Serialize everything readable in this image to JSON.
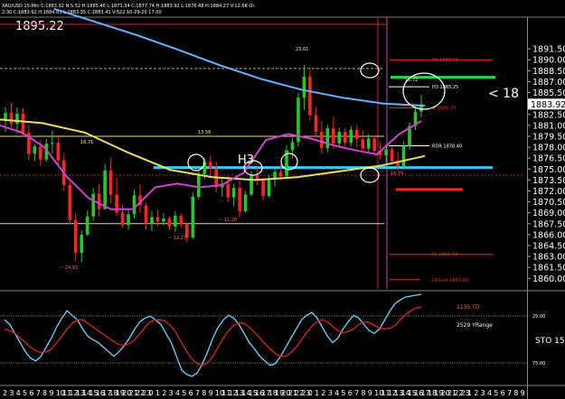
{
  "chart_data": [
    {
      "type": "candlestick",
      "header": "XAU/USD  15-Min  C:1883.92  N:5.52  H:1885.46  L:1873.34  C:1877.74  H:1883.92  L:1876.48  H:1884.27  V:12.6K  Oi:",
      "header2": "2:30  C:1883.92  H:1884.83  L:1883.35  C:1883.41  V:522  10-29-20  17:00",
      "corner_price": "1895.22",
      "price_axis": {
        "ticks": [
          "1891.50",
          "1890.00",
          "1888.50",
          "1887.00",
          "1885.50",
          "1884.00",
          "1882.50",
          "1881.00",
          "1879.50",
          "1878.00",
          "1876.50",
          "1875.00",
          "1873.50",
          "1872.00",
          "1870.50",
          "1869.00",
          "1867.50",
          "1866.00",
          "1864.50",
          "1863.00",
          "1861.50",
          "1860.00"
        ],
        "ylim": [
          1858.8,
          1893.5
        ],
        "last_price": "1883.92",
        "scale_note": "STO 15"
      },
      "x_axis": {
        "labels": [
          "2",
          "3",
          "4",
          "5",
          "6",
          "7",
          "8",
          "9",
          "10",
          "11",
          "12",
          "13",
          "14",
          "15",
          "16",
          "17",
          "18",
          "19",
          "20",
          "21",
          "22",
          "23",
          "0",
          "1",
          "2",
          "3",
          "4",
          "5",
          "6",
          "7",
          "8",
          "9",
          "10",
          "11",
          "12",
          "13",
          "14",
          "15",
          "16",
          "17",
          "18",
          "19",
          "20",
          "21",
          "22",
          "23",
          "0",
          "1",
          "2",
          "3",
          "4",
          "5",
          "6",
          "7",
          "8",
          "9",
          "10",
          "11",
          "12",
          "13",
          "14",
          "15",
          "16",
          "17",
          "18",
          "19",
          "20",
          "21",
          "22",
          "23",
          "1",
          "2",
          "3",
          "4",
          "5",
          "6",
          "7",
          "8",
          "9"
        ]
      },
      "candles": [
        [
          1881.6,
          1883.5,
          1880.1,
          1882.7
        ],
        [
          1882.7,
          1884.1,
          1880.7,
          1881.2
        ],
        [
          1881.2,
          1883.5,
          1879.9,
          1882.6
        ],
        [
          1882.6,
          1883.4,
          1879.4,
          1880.0
        ],
        [
          1880.0,
          1881.1,
          1876.2,
          1877.1
        ],
        [
          1877.1,
          1878.4,
          1876.1,
          1878.1
        ],
        [
          1878.1,
          1879.0,
          1875.4,
          1876.3
        ],
        [
          1876.3,
          1879.1,
          1876.0,
          1878.5
        ],
        [
          1878.5,
          1880.3,
          1877.1,
          1878.6
        ],
        [
          1878.6,
          1879.5,
          1875.6,
          1876.2
        ],
        [
          1876.2,
          1877.1,
          1872.0,
          1872.8
        ],
        [
          1872.8,
          1873.3,
          1867.4,
          1868.0
        ],
        [
          1868.0,
          1868.9,
          1862.4,
          1863.5
        ],
        [
          1863.5,
          1866.6,
          1862.2,
          1866.0
        ],
        [
          1866.0,
          1869.3,
          1865.8,
          1868.5
        ],
        [
          1868.5,
          1872.4,
          1867.9,
          1871.6
        ],
        [
          1871.6,
          1872.9,
          1868.5,
          1869.5
        ],
        [
          1869.5,
          1875.7,
          1869.4,
          1874.8
        ],
        [
          1874.8,
          1876.6,
          1870.3,
          1871.5
        ],
        [
          1871.5,
          1873.8,
          1868.6,
          1869.0
        ],
        [
          1869.0,
          1870.1,
          1866.9,
          1867.3
        ],
        [
          1867.3,
          1869.6,
          1866.7,
          1868.8
        ],
        [
          1868.8,
          1872.2,
          1868.2,
          1871.4
        ],
        [
          1871.4,
          1872.9,
          1868.9,
          1870.0
        ],
        [
          1870.0,
          1870.4,
          1866.7,
          1867.5
        ],
        [
          1867.5,
          1869.2,
          1866.5,
          1868.4
        ],
        [
          1868.4,
          1869.4,
          1867.2,
          1867.8
        ],
        [
          1867.8,
          1869.0,
          1867.3,
          1868.2
        ],
        [
          1868.2,
          1868.5,
          1866.6,
          1867.1
        ],
        [
          1867.1,
          1869.2,
          1866.4,
          1868.6
        ],
        [
          1868.6,
          1868.9,
          1866.9,
          1867.4
        ],
        [
          1867.4,
          1867.7,
          1865.0,
          1865.6
        ],
        [
          1865.6,
          1871.8,
          1865.4,
          1871.2
        ],
        [
          1871.2,
          1875.0,
          1870.9,
          1874.3
        ],
        [
          1874.3,
          1876.5,
          1873.6,
          1876.0
        ],
        [
          1876.0,
          1876.9,
          1874.2,
          1875.1
        ],
        [
          1875.1,
          1876.0,
          1871.8,
          1872.5
        ],
        [
          1872.5,
          1873.9,
          1871.2,
          1873.0
        ],
        [
          1873.0,
          1874.1,
          1870.5,
          1871.1
        ],
        [
          1871.1,
          1873.0,
          1869.9,
          1872.4
        ],
        [
          1872.4,
          1873.3,
          1868.3,
          1869.2
        ],
        [
          1869.2,
          1872.0,
          1869.0,
          1871.5
        ],
        [
          1871.5,
          1874.7,
          1871.3,
          1874.1
        ],
        [
          1874.1,
          1875.3,
          1872.8,
          1873.6
        ],
        [
          1873.6,
          1873.8,
          1870.7,
          1871.3
        ],
        [
          1871.3,
          1874.2,
          1871.1,
          1873.7
        ],
        [
          1873.7,
          1875.0,
          1872.6,
          1874.6
        ],
        [
          1874.6,
          1875.6,
          1873.5,
          1874.0
        ],
        [
          1874.0,
          1878.3,
          1873.8,
          1877.6
        ],
        [
          1877.6,
          1879.3,
          1876.4,
          1878.7
        ],
        [
          1878.7,
          1885.5,
          1878.1,
          1884.8
        ],
        [
          1884.8,
          1889.3,
          1883.1,
          1887.7
        ],
        [
          1887.7,
          1888.9,
          1881.7,
          1882.4
        ],
        [
          1882.4,
          1883.5,
          1879.2,
          1880.1
        ],
        [
          1880.1,
          1881.6,
          1877.1,
          1877.9
        ],
        [
          1877.9,
          1881.1,
          1877.3,
          1880.6
        ],
        [
          1880.6,
          1882.2,
          1877.8,
          1878.5
        ],
        [
          1878.5,
          1880.7,
          1877.9,
          1880.1
        ],
        [
          1880.1,
          1880.6,
          1877.9,
          1878.6
        ],
        [
          1878.6,
          1880.9,
          1878.1,
          1880.4
        ],
        [
          1880.4,
          1881.0,
          1878.0,
          1879.1
        ],
        [
          1879.1,
          1880.3,
          1877.2,
          1877.8
        ],
        [
          1877.8,
          1879.8,
          1877.3,
          1879.2
        ],
        [
          1879.2,
          1879.7,
          1876.9,
          1877.5
        ],
        [
          1877.5,
          1878.6,
          1876.3,
          1876.9
        ],
        [
          1876.9,
          1878.4,
          1875.8,
          1877.7
        ],
        [
          1877.7,
          1878.2,
          1875.6,
          1876.1
        ],
        [
          1876.1,
          1877.4,
          1874.8,
          1875.4
        ],
        [
          1875.4,
          1878.8,
          1875.1,
          1878.2
        ],
        [
          1878.2,
          1881.4,
          1877.7,
          1880.9
        ],
        [
          1880.9,
          1883.6,
          1880.4,
          1882.9
        ],
        [
          1882.9,
          1885.2,
          1882.1,
          1883.9
        ]
      ],
      "moving_averages": [
        {
          "color": "#66b3ff",
          "values": [
            1897.0,
            1895.2,
            1893.4,
            1891.4,
            1889.3,
            1887.4,
            1885.9,
            1884.8,
            1884.0,
            1883.7
          ]
        },
        {
          "color": "#e8e060",
          "values": [
            1881.8,
            1881.3,
            1880.0,
            1877.3,
            1874.9,
            1873.9,
            1873.5,
            1873.9,
            1874.7,
            1875.5,
            1876.8
          ]
        },
        {
          "color": "#d43fd1",
          "values": [
            1881.0,
            1880.0,
            1878.0,
            1874.0,
            1871.0,
            1869.5,
            1869.5,
            1872.5,
            1873.0,
            1872.5,
            1872.8,
            1874.5,
            1879.0,
            1879.8,
            1879.2,
            1878.3,
            1877.6,
            1877.0,
            1879.8,
            1881.6
          ]
        }
      ],
      "horizontal_levels": [
        {
          "price": 1875.2,
          "color": "#33ccff",
          "label": "H3",
          "emphasis": true
        },
        {
          "price": 1887.6,
          "color": "#22dd44",
          "label": "",
          "emphasis": true
        },
        {
          "price": 1888.8,
          "color": "#22dd44",
          "label": "",
          "emphasis": true
        },
        {
          "price": 1879.5,
          "color": "#e8e060",
          "label": ""
        },
        {
          "price": 1867.5,
          "color": "#e8e060",
          "label": ""
        },
        {
          "price": 1872.2,
          "color": "#ff2222",
          "label": "",
          "emphasis": true
        },
        {
          "price": 1890.0,
          "color": "#ff2222",
          "label": "FH 1889.63"
        },
        {
          "price": 1886.3,
          "color": "#ffffff",
          "label": "H3 1885.25"
        },
        {
          "price": 1883.4,
          "color": "#ff2222",
          "label": "# 1883.70"
        },
        {
          "price": 1878.2,
          "color": "#ffffff",
          "label": "RDR 1878.40"
        },
        {
          "price": 1863.3,
          "color": "#ff2222",
          "label": "FL 1863.34"
        },
        {
          "price": 1859.8,
          "color": "#ff2222",
          "label": "LR Low 1859.90"
        }
      ],
      "annotations": [
        {
          "text": "23.01",
          "color": "#ffff66"
        },
        {
          "text": "16.71",
          "color": "#ffff66"
        },
        {
          "text": "13.56",
          "color": "#ffff66"
        },
        {
          "text": "~ 12.27",
          "color": "#ff6666"
        },
        {
          "text": "~ 11.28",
          "color": "#ff6666"
        },
        {
          "text": "~ 24.93",
          "color": "#ff6666"
        },
        {
          "text": "18.72",
          "color": "#ffff66"
        },
        {
          "text": "16.75",
          "color": "#ff6666"
        },
        {
          "text": "< 18",
          "color": "#ffffff"
        },
        {
          "text": "H3",
          "color": "#ffffff"
        }
      ]
    },
    {
      "type": "line",
      "oscillator": "STO 15",
      "ticks": [
        "25.00",
        "75.00"
      ],
      "labels": [
        {
          "text": "1135 TD",
          "color": "#ff6666"
        },
        {
          "text": "2529 YRange",
          "color": "#ffffff"
        }
      ],
      "series": [
        {
          "color": "#66d9ff",
          "values": [
            70,
            65,
            55,
            45,
            35,
            28,
            25,
            30,
            40,
            50,
            62,
            72,
            80,
            75,
            70,
            60,
            52,
            48,
            45,
            40,
            35,
            30,
            35,
            42,
            50,
            60,
            68,
            72,
            74,
            70,
            65,
            55,
            45,
            30,
            15,
            10,
            8,
            12,
            22,
            35,
            50,
            62,
            70,
            75,
            72,
            65,
            55,
            45,
            38,
            30,
            25,
            20,
            22,
            30,
            40,
            50,
            60,
            70,
            75,
            78,
            72,
            62,
            52,
            45,
            50,
            60,
            68,
            75,
            72,
            65,
            58,
            55,
            60,
            70,
            80,
            88,
            92,
            95,
            96,
            97,
            98
          ]
        },
        {
          "color": "#dd2222",
          "values": [
            60,
            58,
            55,
            50,
            45,
            40,
            36,
            34,
            35,
            38,
            45,
            52,
            60,
            66,
            70,
            70,
            66,
            62,
            58,
            54,
            50,
            46,
            43,
            42,
            44,
            48,
            55,
            62,
            68,
            70,
            70,
            68,
            63,
            55,
            45,
            35,
            27,
            22,
            20,
            23,
            30,
            40,
            50,
            58,
            64,
            67,
            66,
            62,
            56,
            50,
            44,
            38,
            33,
            30,
            30,
            34,
            40,
            48,
            56,
            63,
            68,
            70,
            68,
            63,
            58,
            56,
            57,
            60,
            65,
            68,
            67,
            64,
            61,
            60,
            61,
            64,
            70,
            76,
            80,
            83,
            84
          ]
        }
      ]
    }
  ]
}
